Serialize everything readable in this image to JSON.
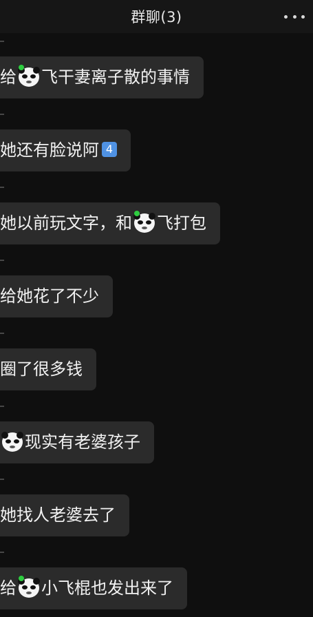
{
  "header": {
    "title": "群聊(3)"
  },
  "messages": [
    {
      "pre": "给",
      "post": "飞干妻离子散的事情"
    },
    {
      "text": "她还有脸说阿",
      "badge": "4"
    },
    {
      "pre": "她以前玩文字，和",
      "post": "飞打包"
    },
    {
      "text": "给她花了不少"
    },
    {
      "text": "圈了很多钱"
    },
    {
      "text": "现实有老婆孩子"
    },
    {
      "text": "她找人老婆去了"
    },
    {
      "pre": "给",
      "post": "小飞棍也发出来了"
    }
  ],
  "colors": {
    "background": "#0f0f0f",
    "bubble": "#2b2b2b",
    "text": "#f2f2f2",
    "badge": "#4f92e4",
    "emoji_dot": "#2ecc40"
  },
  "icons": {
    "more": "more-dots-icon",
    "emoji": "panda-face-emoji-icon"
  }
}
